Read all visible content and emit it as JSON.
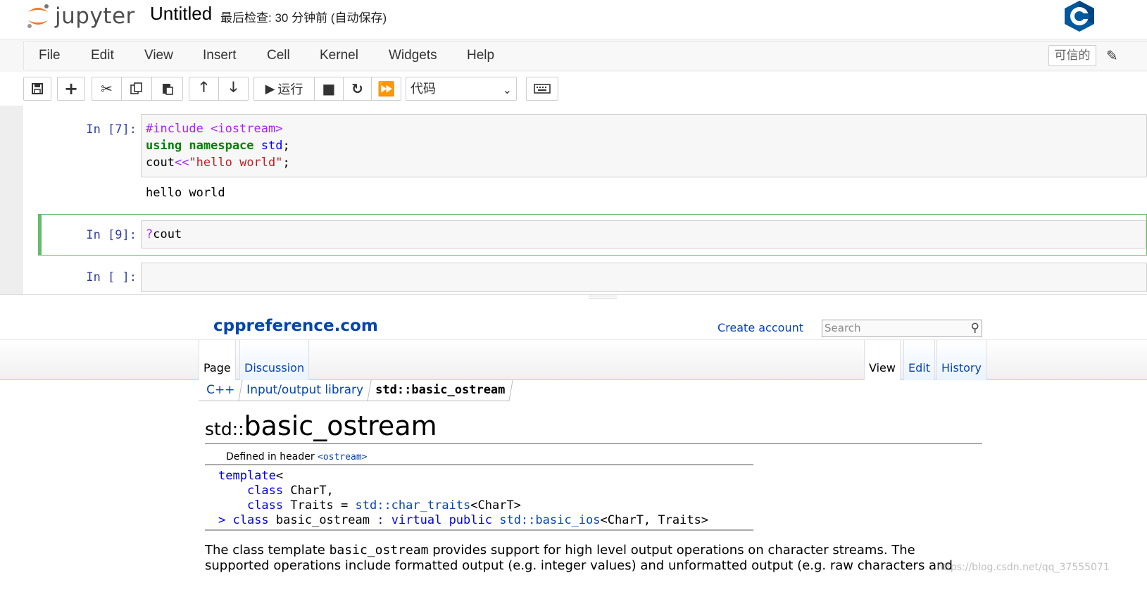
{
  "header": {
    "logo_text": "jupyter",
    "notebook_title": "Untitled",
    "checkpoint": "最后检查: 30 分钟前  (自动保存)",
    "kernel_logo": "cpp-kernel-logo"
  },
  "menubar": {
    "items": [
      "File",
      "Edit",
      "View",
      "Insert",
      "Cell",
      "Kernel",
      "Widgets",
      "Help"
    ],
    "trusted_label": "可信的",
    "edit_icon": "pencil-icon"
  },
  "toolbar": {
    "run_label": "运行",
    "cell_type": "代码",
    "icons": [
      "save-icon",
      "plus-icon",
      "cut-icon",
      "copy-icon",
      "paste-icon",
      "arrow-up-icon",
      "arrow-down-icon",
      "play-icon",
      "stop-icon",
      "restart-icon",
      "fast-forward-icon",
      "keyboard-icon"
    ]
  },
  "cells": [
    {
      "prompt": "In  [7]:",
      "code_lines": [
        "#include <iostream>",
        "using namespace std;",
        "cout<<\"hello world\";"
      ],
      "output": "hello world"
    },
    {
      "prompt": "In  [9]:",
      "code": "?cout"
    },
    {
      "prompt": "In  [ ]:",
      "code": ""
    }
  ],
  "pager": {
    "site_name": "cppreference.com",
    "create_account": "Create account",
    "search_placeholder": "Search",
    "tabs_left": [
      "Page",
      "Discussion"
    ],
    "tabs_right": [
      "View",
      "Edit",
      "History"
    ],
    "breadcrumb": [
      "C++",
      "Input/output library",
      "std::basic_ostream"
    ],
    "title_prefix": "std::",
    "title_main": "basic_ostream",
    "defined_in_label": "Defined in header ",
    "defined_in_header": "<ostream>",
    "declaration": {
      "line1_kw": "template",
      "line1_rest": "<",
      "line2_kw": "class",
      "line2_rest": " CharT,",
      "line3_kw": "class",
      "line3_mid": " Traits = ",
      "line3_link": "std::char_traits",
      "line3_rest": "<CharT>",
      "line4_pre": "> ",
      "line4_kw": "class",
      "line4_name": " basic_ostream ",
      "line4_colon": ": ",
      "line4_kw2": "virtual public",
      "line4_link": " std::basic_ios",
      "line4_rest": "<CharT, Traits>"
    },
    "description_pre": "The class template ",
    "description_code": "basic_ostream",
    "description_post": " provides support for high level output operations on character streams. The supported operations include formatted output (e.g. integer values) and unformatted output (e.g. raw characters and",
    "watermark": "https://blog.csdn.net/qq_37555071"
  },
  "colors": {
    "jupyter_orange": "#f37726",
    "selected_cell_border": "#66bb6a",
    "prompt_blue": "#303f9f",
    "link_blue": "#0645ad"
  }
}
